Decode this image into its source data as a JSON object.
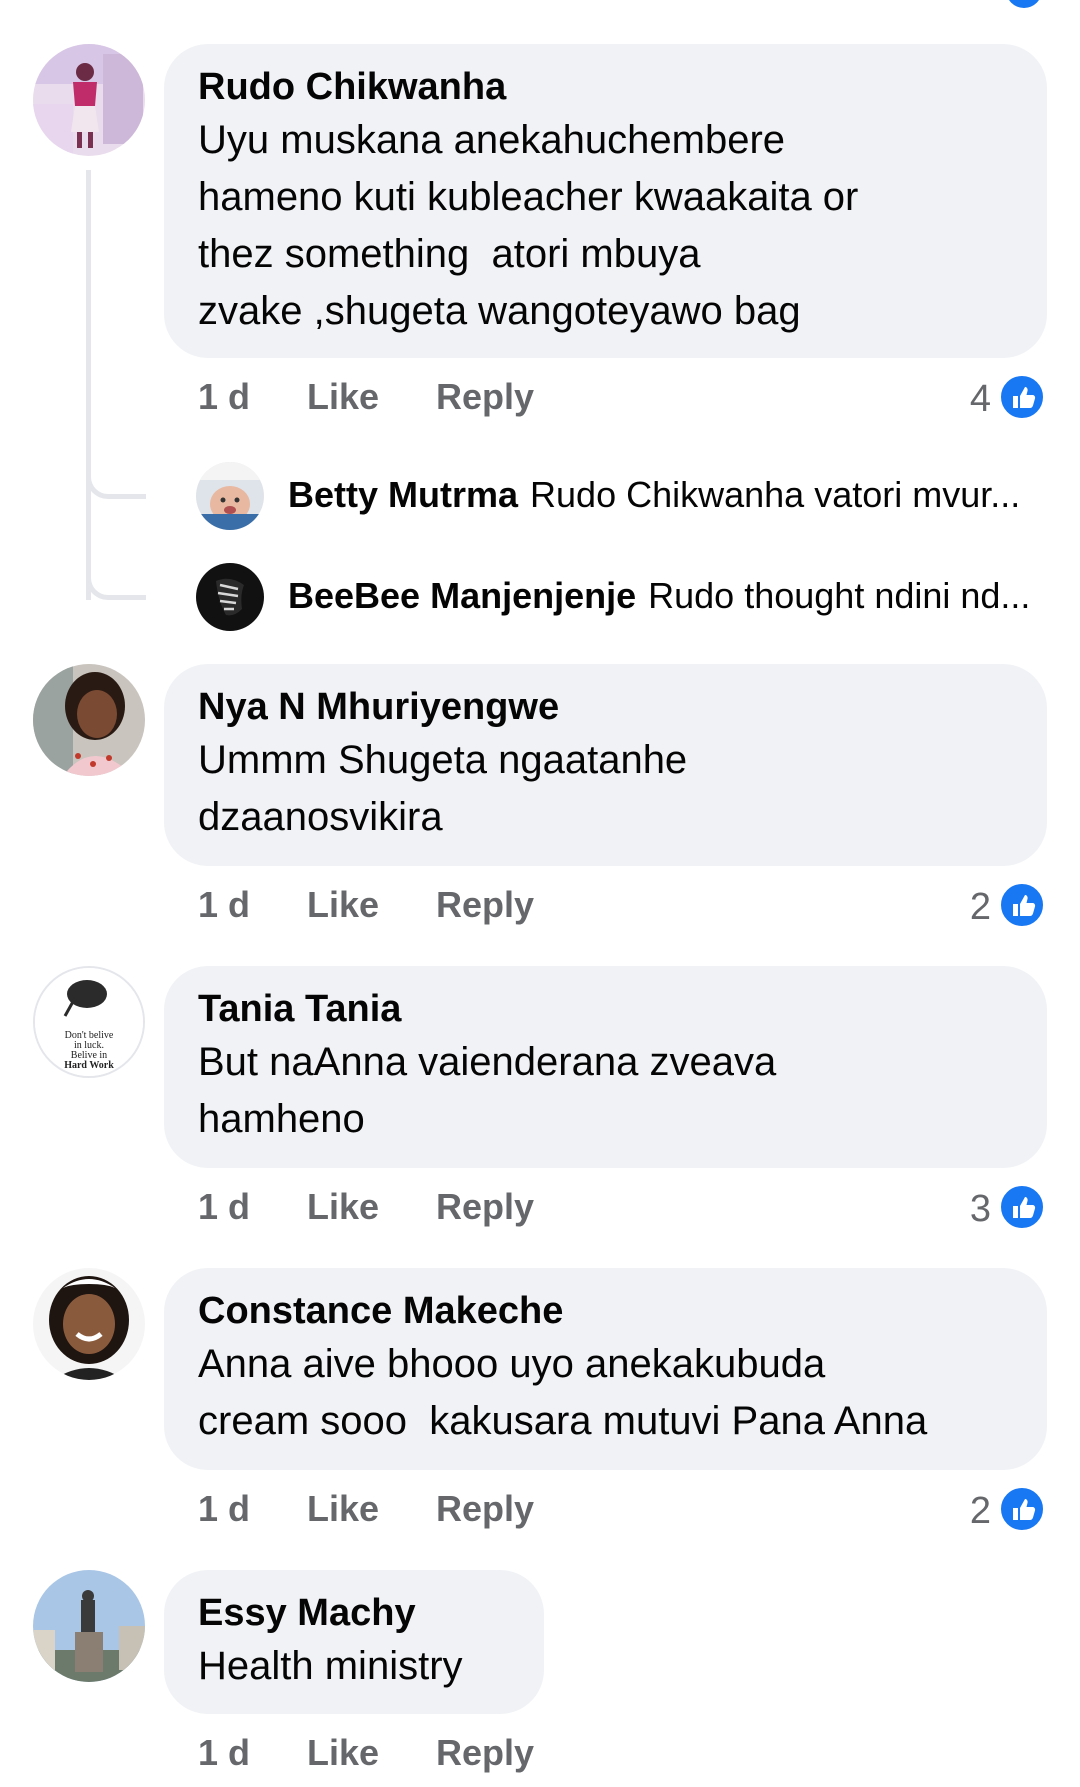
{
  "colors": {
    "bubble_bg": "#f0f2f5",
    "meta_text": "#65676b",
    "like_blue": "#1877f2",
    "thread_line": "#e4e6eb"
  },
  "comments": [
    {
      "author": "Rudo Chikwanha",
      "text": "Uyu muskana anekahuchembere\nhameno kuti kubleacher kwaakaita or\nthez something  atori mbuya\nzvake ,shugeta wangoteyawo bag",
      "time": "1 d",
      "like_label": "Like",
      "reply_label": "Reply",
      "reaction_count": "4",
      "avatar_icon": "avatar-woman-pink-icon",
      "replies": [
        {
          "author": "Betty Mutrma",
          "snippet": "Rudo Chikwanha vatori mvur...",
          "avatar_icon": "avatar-baby-icon"
        },
        {
          "author": "BeeBee Manjenjenje",
          "snippet": "Rudo thought ndini nd...",
          "avatar_icon": "avatar-zebra-icon"
        }
      ]
    },
    {
      "author": "Nya N Mhuriyengwe",
      "text": "Ummm Shugeta ngaatanhe\ndzaanosvikira",
      "time": "1 d",
      "like_label": "Like",
      "reply_label": "Reply",
      "reaction_count": "2",
      "avatar_icon": "avatar-woman-icon"
    },
    {
      "author": "Tania Tania",
      "text": "But naAnna vaienderana zveava\nhamheno",
      "time": "1 d",
      "like_label": "Like",
      "reply_label": "Reply",
      "reaction_count": "3",
      "avatar_icon": "avatar-quote-icon",
      "avatar_text": "Don't belive\nin luck.\nBelive in\nHard Work"
    },
    {
      "author": "Constance Makeche",
      "text": "Anna aive bhooo uyo anekakubuda\ncream sooo  kakusara mutuvi Pana Anna",
      "time": "1 d",
      "like_label": "Like",
      "reply_label": "Reply",
      "reaction_count": "2",
      "avatar_icon": "avatar-smiling-woman-icon"
    },
    {
      "author": "Essy Machy",
      "text": "Health ministry",
      "time": "1 d",
      "like_label": "Like",
      "reply_label": "Reply",
      "avatar_icon": "avatar-statue-icon"
    }
  ]
}
